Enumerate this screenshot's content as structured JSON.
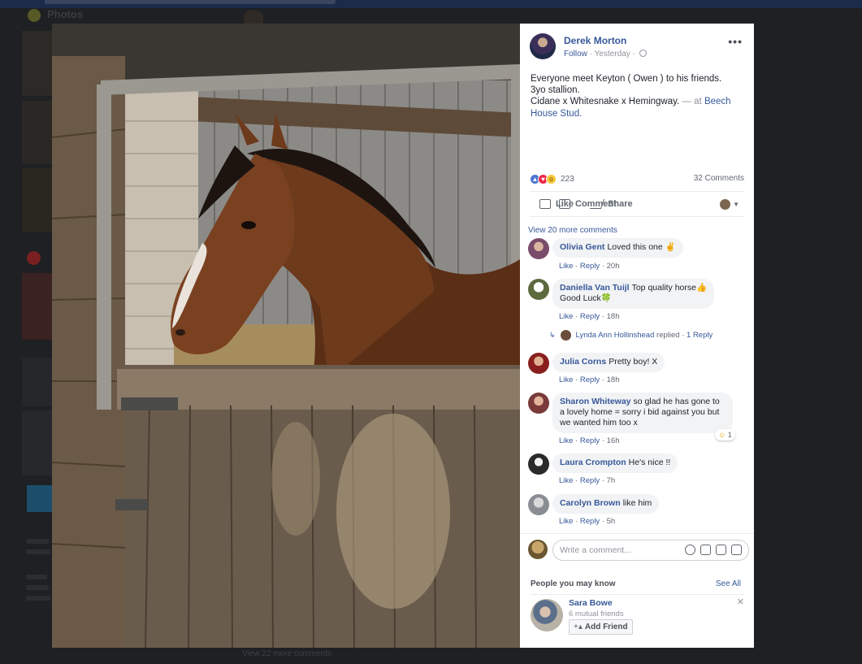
{
  "background": {
    "photos_title": "Photos",
    "bottom_text": "View 22 more comments"
  },
  "post": {
    "author": "Derek Morton",
    "follow_label": "Follow",
    "time": "Yesterday",
    "text_line1": "Everyone meet Keyton ( Owen ) to his friends.",
    "text_line2": "3yo stallion.",
    "text_line3": "Cidane x Whitesnake x Hemingway.",
    "at_label": "— at",
    "place": "Beech House Stud.",
    "reactions_count": "223",
    "comments_count": "32 Comments",
    "actions": {
      "like": "Like",
      "comment": "Comment",
      "share": "Share"
    }
  },
  "comments_section": {
    "view_more": "View 20 more comments",
    "like_label": "Like",
    "reply_label": "Reply",
    "items": [
      {
        "name": "Olivia Gent",
        "text": "Loved this one ✌",
        "text2": "",
        "time": "20h"
      },
      {
        "name": "Daniella Van Tuijl",
        "text": "Top quality horse👍",
        "text2": "Good Luck🍀",
        "time": "18h"
      },
      {
        "name": "Julia Corns",
        "text": "Pretty boy! X",
        "text2": "",
        "time": "18h"
      },
      {
        "name": "Sharon Whiteway",
        "text": "so glad he has gone to",
        "text2": "a lovely home = sorry i bid against you but",
        "text3": "we wanted him too x",
        "time": "16h",
        "reaction_count": "1"
      },
      {
        "name": "Laura Crompton",
        "text": "He's nice !!",
        "text2": "",
        "time": "7h"
      },
      {
        "name": "Carolyn Brown",
        "text": "like him",
        "text2": "",
        "time": "5h"
      }
    ],
    "reply_thread": {
      "name": "Lynda Ann Hollinshead",
      "replied": "replied",
      "count": "1 Reply"
    }
  },
  "write_comment": {
    "placeholder": "Write a comment..."
  },
  "people_you_may_know": {
    "title": "People you may know",
    "see_all": "See All",
    "person": {
      "name": "Sara Bowe",
      "mutual": "6 mutual friends",
      "add_label": "Add Friend"
    }
  }
}
